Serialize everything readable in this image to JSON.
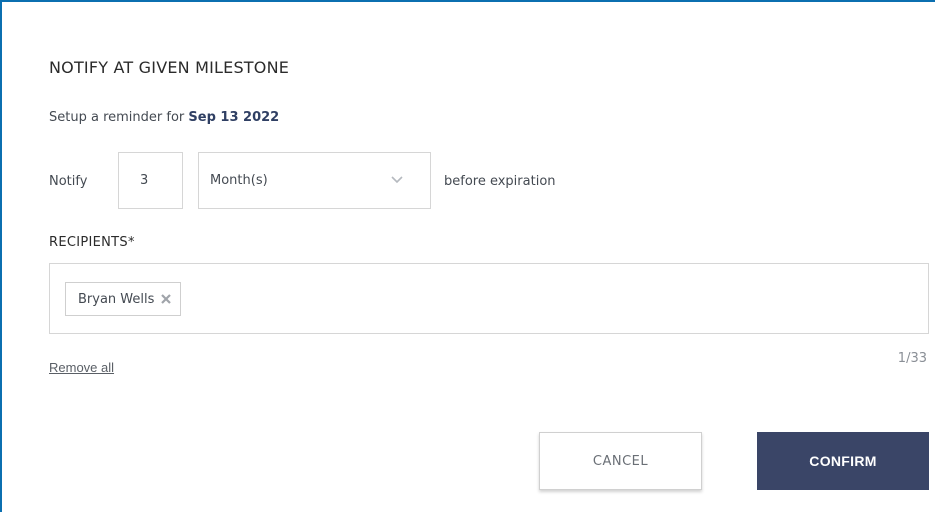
{
  "dialog": {
    "title": "NOTIFY AT GIVEN MILESTONE",
    "subtitle_prefix": "Setup a reminder for",
    "subtitle_date": "Sep 13 2022"
  },
  "notify": {
    "label": "Notify",
    "quantity_value": "3",
    "unit_selected": "Month(s)",
    "unit_icon": "chevron-down-icon",
    "after_label": "before expiration"
  },
  "recipients": {
    "label": "RECIPIENTS*",
    "chips": [
      {
        "name": "Bryan Wells",
        "remove_icon": "close-icon"
      }
    ],
    "remove_all_label": "Remove all",
    "counter": "1/33"
  },
  "actions": {
    "cancel_label": "CANCEL",
    "confirm_label": "CONFIRM"
  },
  "colors": {
    "accent_border": "#0b6fb0",
    "confirm_bg": "#3a4567",
    "date_text": "#2f3f63"
  }
}
